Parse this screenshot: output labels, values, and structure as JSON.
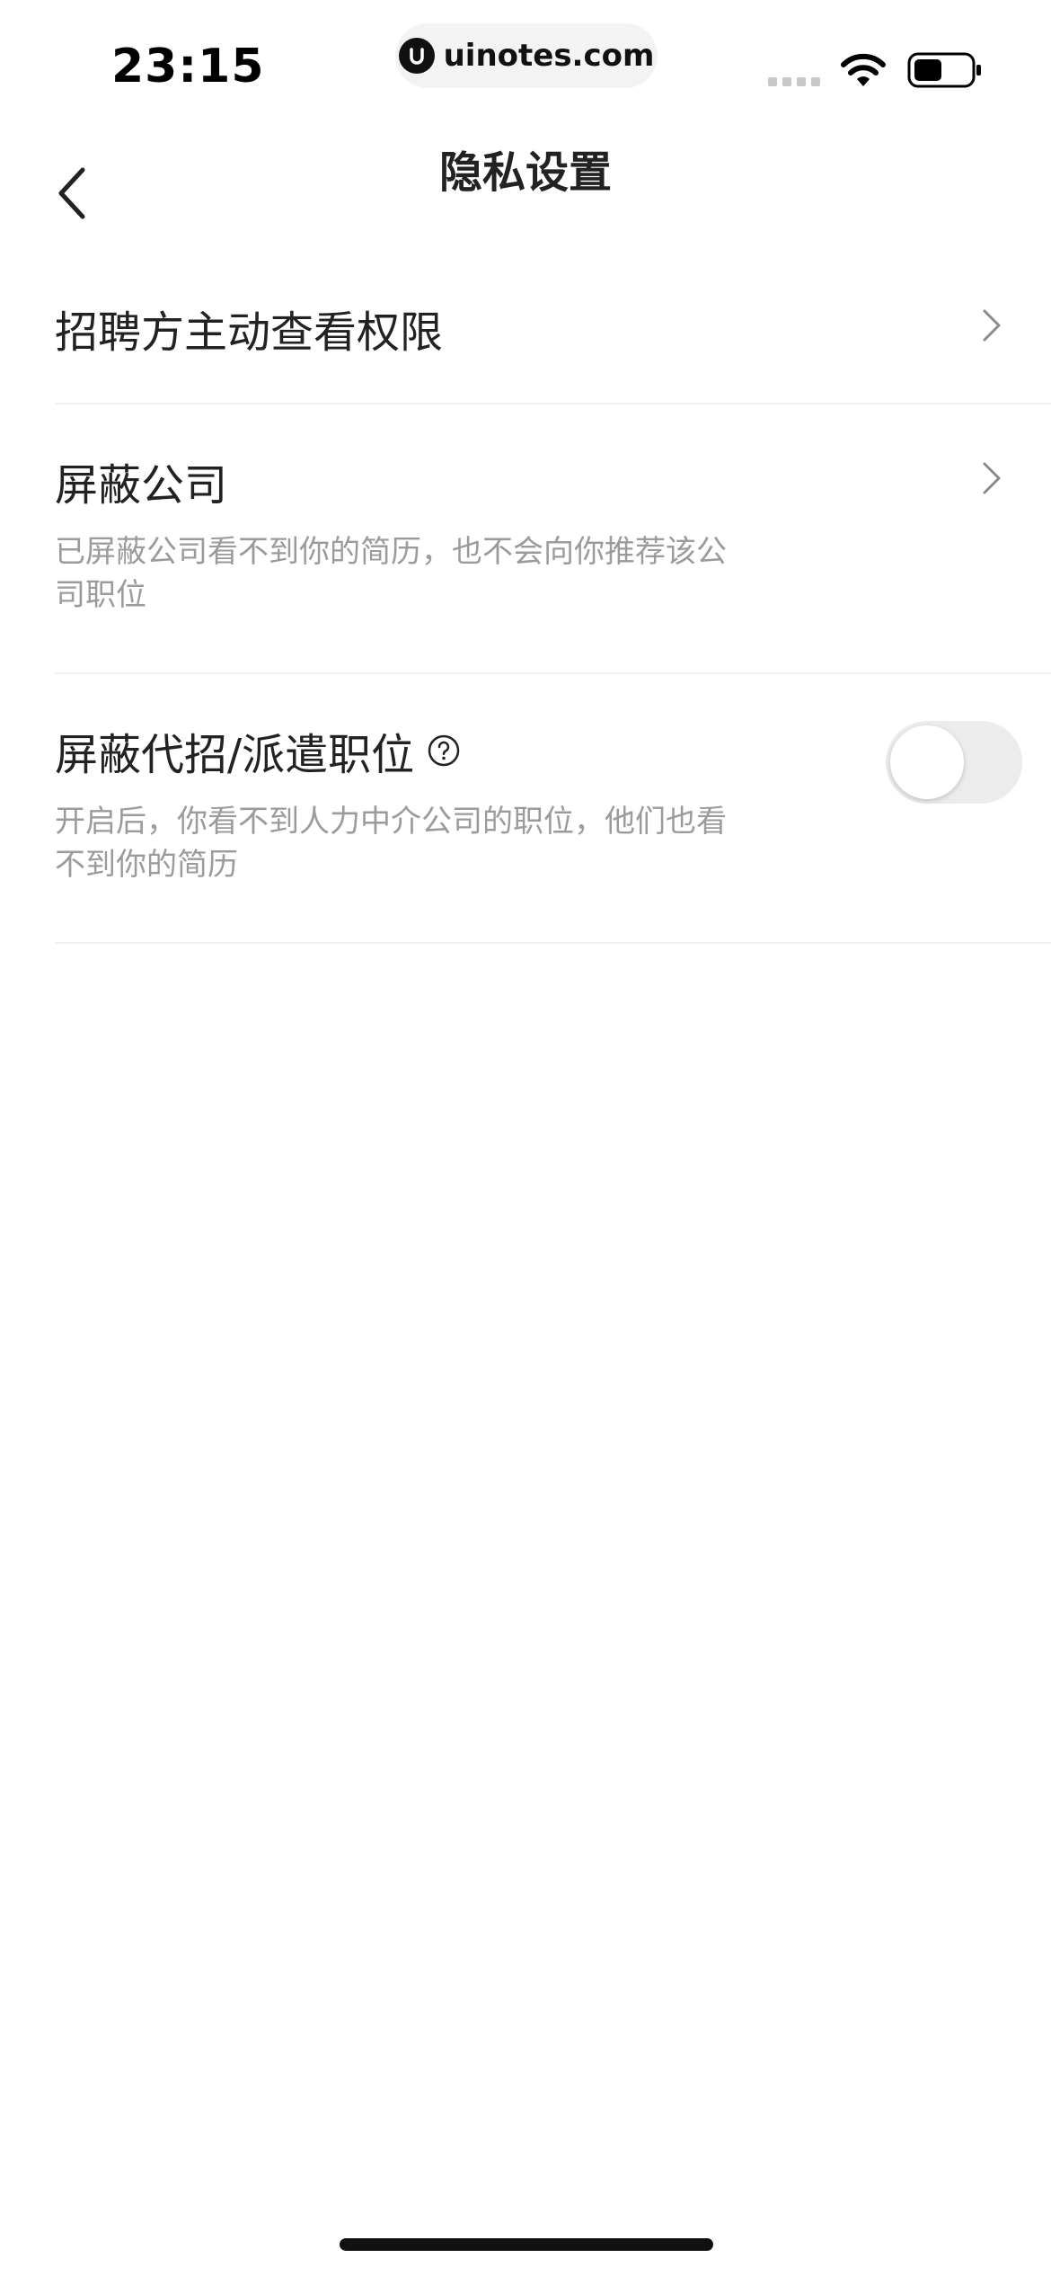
{
  "status_bar": {
    "time": "23:15",
    "url": "uinotes.com"
  },
  "nav": {
    "title": "隐私设置"
  },
  "items": [
    {
      "title": "招聘方主动查看权限",
      "subtitle": "",
      "control": "chevron"
    },
    {
      "title": "屏蔽公司",
      "subtitle": "已屏蔽公司看不到你的简历，也不会向你推荐该公司职位",
      "control": "chevron"
    },
    {
      "title": "屏蔽代招/派遣职位",
      "subtitle": "开启后，你看不到人力中介公司的职位，他们也看不到你的简历",
      "control": "toggle",
      "toggle_on": false
    }
  ],
  "colors": {
    "title_text": "#222222",
    "subtitle_text": "#9b9b9b",
    "divider": "#f0f0f0",
    "toggle_off_track": "#ececec"
  }
}
